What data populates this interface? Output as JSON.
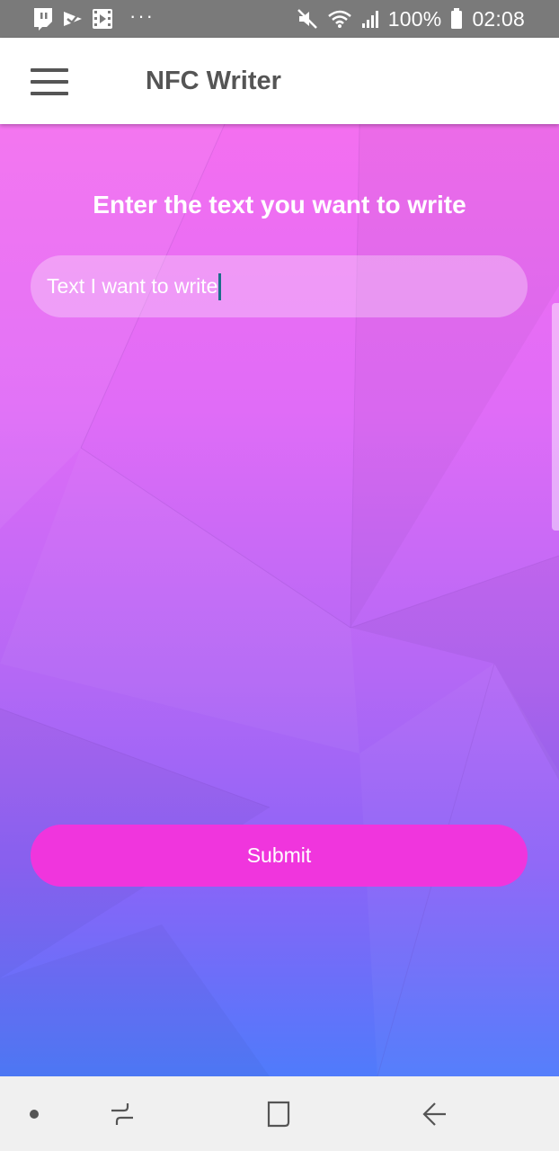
{
  "status_bar": {
    "notification_icons": [
      "twitch-icon",
      "pushbullet-icon",
      "video-icon"
    ],
    "more_indicator": "···",
    "battery": "100%",
    "time": "02:08",
    "system_icons": [
      "mute-icon",
      "wifi-icon",
      "signal-icon",
      "battery-icon"
    ]
  },
  "app_bar": {
    "title": "NFC Writer",
    "menu_icon": "hamburger-menu-icon"
  },
  "main": {
    "prompt": "Enter the text you want to write",
    "input_value": "Text I want to write",
    "submit_label": "Submit"
  },
  "nav_bar": {
    "items": [
      "nav-dot-icon",
      "recent-apps-icon",
      "home-icon",
      "back-icon"
    ]
  },
  "colors": {
    "status_bar": "#7a7a7a",
    "app_bar": "#ffffff",
    "title_text": "#555555",
    "gradient_top": "#f46ff0",
    "gradient_bottom": "#4f7bfb",
    "submit_button": "#f035dd",
    "nav_bar": "#f0f0f0"
  }
}
